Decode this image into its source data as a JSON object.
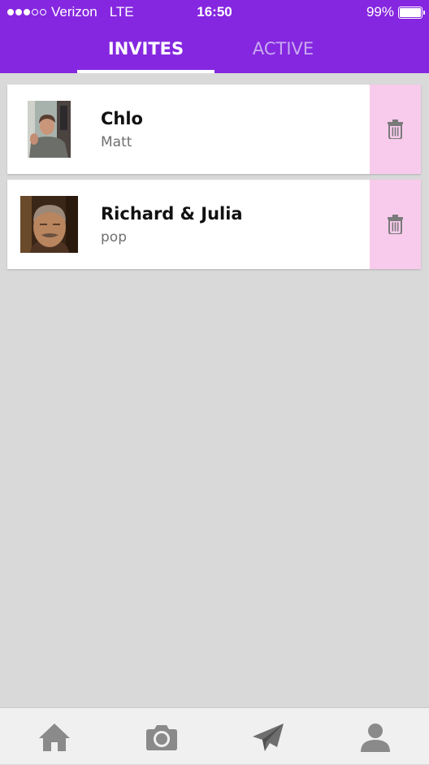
{
  "status_bar": {
    "carrier": "Verizon",
    "network": "LTE",
    "time": "16:50",
    "battery": "99%",
    "battery_level": 0.99,
    "signal_bars_filled": 3,
    "signal_bars_total": 5
  },
  "tabs": [
    {
      "label": "INVITES",
      "selected": true
    },
    {
      "label": "ACTIVE",
      "selected": false
    }
  ],
  "invites": [
    {
      "name": "Chlo",
      "subtitle": "Matt",
      "avatar": "person-photo"
    },
    {
      "name": "Richard & Julia",
      "subtitle": "pop",
      "avatar": "person-photo"
    }
  ],
  "bottom_nav": [
    {
      "icon": "home-icon"
    },
    {
      "icon": "camera-icon"
    },
    {
      "icon": "paper-plane-icon"
    },
    {
      "icon": "user-icon"
    }
  ],
  "colors": {
    "header": "#8527e0",
    "tab_inactive": "#c8a9f1",
    "background": "#d9d9d9",
    "delete_action": "#f8cbec",
    "nav_icon": "#8a8a8a"
  }
}
